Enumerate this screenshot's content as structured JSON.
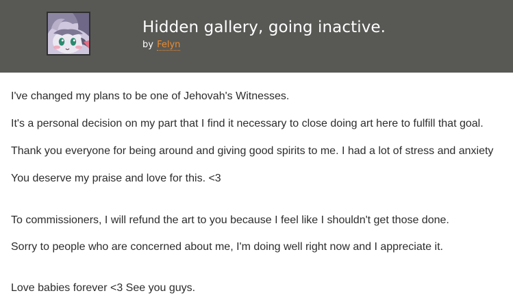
{
  "post": {
    "title": "Hidden gallery, going inactive.",
    "by_label": "by",
    "author": "Felyn"
  },
  "body": {
    "line1": "I've changed my plans to be one of Jehovah's Witnesses.",
    "line2": "It's a personal decision on my part that I find it necessary to close doing art here to fulfill that goal.",
    "line3": "Thank you everyone for being around and giving good spirits to me. I had a lot of stress and anxiety",
    "line4": "You deserve my praise and love for this. <3",
    "line5": "To commissioners, I will refund the art to you because I feel like I shouldn't get those done.",
    "line6": "Sorry to people who are concerned about me, I'm doing well right now and I appreciate it.",
    "line7": "Love babies forever <3 See you guys."
  },
  "colors": {
    "header_bg": "#585955",
    "author_link": "#f08a2a",
    "body_text": "#2c2c2c"
  }
}
